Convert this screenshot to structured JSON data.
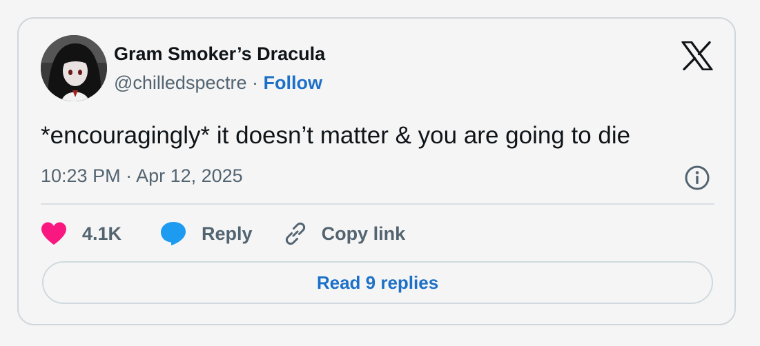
{
  "tweet": {
    "author": {
      "display_name": "Gram Smoker’s Dracula",
      "handle": "@chilledspectre",
      "separator": " · ",
      "follow_label": "Follow"
    },
    "text": "*encouragingly* it doesn’t matter & you are going to die",
    "timestamp": "10:23 PM · Apr 12, 2025",
    "actions": {
      "like_count": "4.1K",
      "reply_label": "Reply",
      "copy_link_label": "Copy link"
    },
    "read_replies_label": "Read 9 replies"
  },
  "icons": {
    "logo": "x-logo-icon",
    "info": "info-icon",
    "like": "heart-icon",
    "reply": "speech-bubble-icon",
    "copy": "link-icon"
  },
  "colors": {
    "background": "#f5f5f5",
    "text_primary": "#0f1419",
    "text_secondary": "#536471",
    "link_blue": "#1d70c7",
    "heart_pink": "#f91880",
    "reply_blue": "#1d9bf0",
    "border": "#d0d7dc"
  }
}
